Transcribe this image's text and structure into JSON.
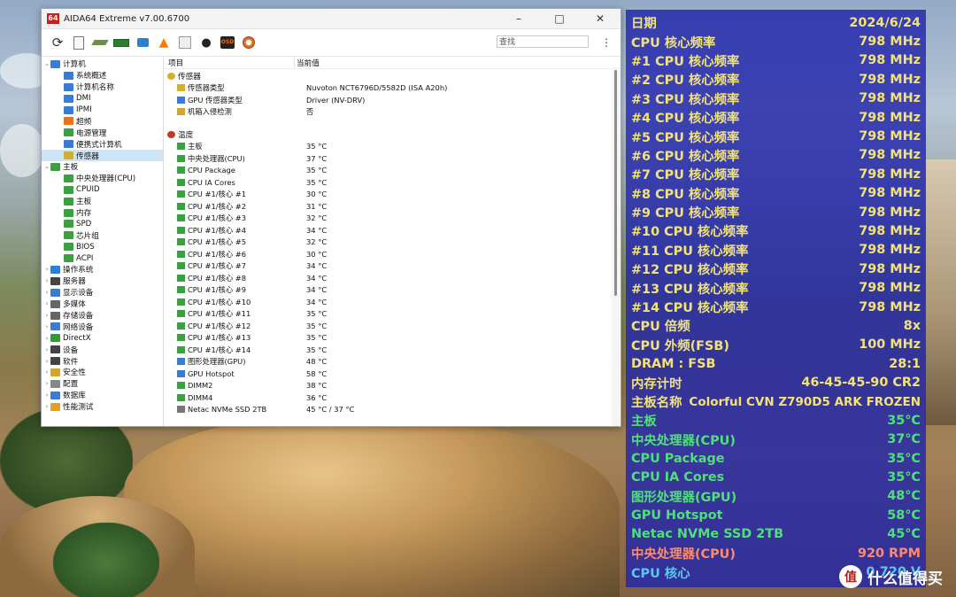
{
  "window": {
    "logo": "64",
    "title": "AIDA64 Extreme v7.00.6700",
    "controls": [
      "–",
      "□",
      "✕"
    ]
  },
  "toolbar": {
    "icons": [
      "refresh-icon",
      "report-icon",
      "motherboard-icon",
      "memory-icon",
      "network-icon",
      "flame-icon",
      "chip-icon",
      "user-icon",
      "osd-icon",
      "gauge-icon"
    ],
    "osd_label": "OSD",
    "search_placeholder": "查找",
    "more": "⋮"
  },
  "tree": [
    {
      "label": "计算机",
      "level": 0,
      "expanded": true,
      "icon_color": "#3a7bd5"
    },
    {
      "label": "系统概述",
      "level": 1,
      "icon_color": "#3a7bd5"
    },
    {
      "label": "计算机名称",
      "level": 1,
      "icon_color": "#3a7bd5"
    },
    {
      "label": "DMI",
      "level": 1,
      "icon_color": "#3a7bd5"
    },
    {
      "label": "IPMI",
      "level": 1,
      "icon_color": "#3a7bd5"
    },
    {
      "label": "超频",
      "level": 1,
      "icon_color": "#e8731a"
    },
    {
      "label": "电源管理",
      "level": 1,
      "icon_color": "#3aa040"
    },
    {
      "label": "便携式计算机",
      "level": 1,
      "icon_color": "#3a7bd5"
    },
    {
      "label": "传感器",
      "level": 1,
      "icon_color": "#d4b02a",
      "selected": true
    },
    {
      "label": "主板",
      "level": 0,
      "expanded": true,
      "icon_color": "#3aa040"
    },
    {
      "label": "中央处理器(CPU)",
      "level": 1,
      "icon_color": "#3aa040"
    },
    {
      "label": "CPUID",
      "level": 1,
      "icon_color": "#3aa040"
    },
    {
      "label": "主板",
      "level": 1,
      "icon_color": "#3aa040"
    },
    {
      "label": "内存",
      "level": 1,
      "icon_color": "#3aa040"
    },
    {
      "label": "SPD",
      "level": 1,
      "icon_color": "#3aa040"
    },
    {
      "label": "芯片组",
      "level": 1,
      "icon_color": "#3aa040"
    },
    {
      "label": "BIOS",
      "level": 1,
      "icon_color": "#3aa040"
    },
    {
      "label": "ACPI",
      "level": 1,
      "icon_color": "#3aa040"
    },
    {
      "label": "操作系统",
      "level": 0,
      "expanded": false,
      "icon_color": "#2a7fd8"
    },
    {
      "label": "服务器",
      "level": 0,
      "expanded": false,
      "icon_color": "#444444"
    },
    {
      "label": "显示设备",
      "level": 0,
      "expanded": false,
      "icon_color": "#3a7bd5"
    },
    {
      "label": "多媒体",
      "level": 0,
      "expanded": false,
      "icon_color": "#666666"
    },
    {
      "label": "存储设备",
      "level": 0,
      "expanded": false,
      "icon_color": "#666666"
    },
    {
      "label": "网络设备",
      "level": 0,
      "expanded": false,
      "icon_color": "#3a7bd5"
    },
    {
      "label": "DirectX",
      "level": 0,
      "expanded": false,
      "icon_color": "#2aa02a"
    },
    {
      "label": "设备",
      "level": 0,
      "expanded": false,
      "icon_color": "#444444"
    },
    {
      "label": "软件",
      "level": 0,
      "expanded": false,
      "icon_color": "#444444"
    },
    {
      "label": "安全性",
      "level": 0,
      "expanded": false,
      "icon_color": "#d4a52a"
    },
    {
      "label": "配置",
      "level": 0,
      "expanded": false,
      "icon_color": "#888888"
    },
    {
      "label": "数据库",
      "level": 0,
      "expanded": false,
      "icon_color": "#3a7bd5"
    },
    {
      "label": "性能测试",
      "level": 0,
      "expanded": false,
      "icon_color": "#e8a01a"
    }
  ],
  "list": {
    "headers": [
      "项目",
      "当前值"
    ],
    "sections": [
      {
        "title": "传感器",
        "icon_color": "#d4b02a",
        "rows": [
          {
            "name": "传感器类型",
            "value": "Nuvoton NCT6796D/5582D  (ISA A20h)",
            "icon_color": "#d4b02a"
          },
          {
            "name": "GPU 传感器类型",
            "value": "Driver  (NV-DRV)",
            "icon_color": "#3a7bd5"
          },
          {
            "name": "机箱入侵检测",
            "value": "否",
            "icon_color": "#d4a52a"
          }
        ]
      },
      {
        "title": "温度",
        "icon_color": "#c0392b",
        "rows": [
          {
            "name": "主板",
            "value": "35 °C",
            "icon_color": "#3aa040"
          },
          {
            "name": "中央处理器(CPU)",
            "value": "37 °C",
            "icon_color": "#3aa040"
          },
          {
            "name": "CPU Package",
            "value": "35 °C",
            "icon_color": "#3aa040"
          },
          {
            "name": "CPU IA Cores",
            "value": "35 °C",
            "icon_color": "#3aa040"
          },
          {
            "name": "CPU #1/核心 #1",
            "value": "30 °C",
            "icon_color": "#3aa040"
          },
          {
            "name": "CPU #1/核心 #2",
            "value": "31 °C",
            "icon_color": "#3aa040"
          },
          {
            "name": "CPU #1/核心 #3",
            "value": "32 °C",
            "icon_color": "#3aa040"
          },
          {
            "name": "CPU #1/核心 #4",
            "value": "34 °C",
            "icon_color": "#3aa040"
          },
          {
            "name": "CPU #1/核心 #5",
            "value": "32 °C",
            "icon_color": "#3aa040"
          },
          {
            "name": "CPU #1/核心 #6",
            "value": "30 °C",
            "icon_color": "#3aa040"
          },
          {
            "name": "CPU #1/核心 #7",
            "value": "34 °C",
            "icon_color": "#3aa040"
          },
          {
            "name": "CPU #1/核心 #8",
            "value": "34 °C",
            "icon_color": "#3aa040"
          },
          {
            "name": "CPU #1/核心 #9",
            "value": "34 °C",
            "icon_color": "#3aa040"
          },
          {
            "name": "CPU #1/核心 #10",
            "value": "34 °C",
            "icon_color": "#3aa040"
          },
          {
            "name": "CPU #1/核心 #11",
            "value": "35 °C",
            "icon_color": "#3aa040"
          },
          {
            "name": "CPU #1/核心 #12",
            "value": "35 °C",
            "icon_color": "#3aa040"
          },
          {
            "name": "CPU #1/核心 #13",
            "value": "35 °C",
            "icon_color": "#3aa040"
          },
          {
            "name": "CPU #1/核心 #14",
            "value": "35 °C",
            "icon_color": "#3aa040"
          },
          {
            "name": "图形处理器(GPU)",
            "value": "48 °C",
            "icon_color": "#3a7bd5"
          },
          {
            "name": "GPU Hotspot",
            "value": "58 °C",
            "icon_color": "#3a7bd5"
          },
          {
            "name": "DIMM2",
            "value": "38 °C",
            "icon_color": "#3aa040"
          },
          {
            "name": "DIMM4",
            "value": "36 °C",
            "icon_color": "#3aa040"
          },
          {
            "name": "Netac NVMe SSD 2TB",
            "value": "45 °C / 37 °C",
            "icon_color": "#777777"
          }
        ]
      }
    ]
  },
  "osd": {
    "rows": [
      {
        "label": "日期",
        "value": "2024/6/24",
        "color": "#f2e27a"
      },
      {
        "label": "CPU 核心频率",
        "value": "798 MHz",
        "color": "#f2e27a"
      },
      {
        "label": "#1 CPU 核心频率",
        "value": "798 MHz",
        "color": "#f2e27a"
      },
      {
        "label": "#2 CPU 核心频率",
        "value": "798 MHz",
        "color": "#f2e27a"
      },
      {
        "label": "#3 CPU 核心频率",
        "value": "798 MHz",
        "color": "#f2e27a"
      },
      {
        "label": "#4 CPU 核心频率",
        "value": "798 MHz",
        "color": "#f2e27a"
      },
      {
        "label": "#5 CPU 核心频率",
        "value": "798 MHz",
        "color": "#f2e27a"
      },
      {
        "label": "#6 CPU 核心频率",
        "value": "798 MHz",
        "color": "#f2e27a"
      },
      {
        "label": "#7 CPU 核心频率",
        "value": "798 MHz",
        "color": "#f2e27a"
      },
      {
        "label": "#8 CPU 核心频率",
        "value": "798 MHz",
        "color": "#f2e27a"
      },
      {
        "label": "#9 CPU 核心频率",
        "value": "798 MHz",
        "color": "#f2e27a"
      },
      {
        "label": "#10 CPU 核心频率",
        "value": "798 MHz",
        "color": "#f2e27a"
      },
      {
        "label": "#11 CPU 核心频率",
        "value": "798 MHz",
        "color": "#f2e27a"
      },
      {
        "label": "#12 CPU 核心频率",
        "value": "798 MHz",
        "color": "#f2e27a"
      },
      {
        "label": "#13 CPU 核心频率",
        "value": "798 MHz",
        "color": "#f2e27a"
      },
      {
        "label": "#14 CPU 核心频率",
        "value": "798 MHz",
        "color": "#f2e27a"
      },
      {
        "label": "CPU 倍频",
        "value": "8x",
        "color": "#f2e27a"
      },
      {
        "label": "CPU 外频(FSB)",
        "value": "100 MHz",
        "color": "#f2e27a"
      },
      {
        "label": "DRAM : FSB",
        "value": "28:1",
        "color": "#f2e27a"
      },
      {
        "label": "内存计时",
        "value": "46-45-45-90 CR2",
        "color": "#f2e27a"
      },
      {
        "label": "主板名称",
        "value": "Colorful CVN Z790D5 ARK FROZEN",
        "color": "#f2e27a"
      },
      {
        "label": "主板",
        "value": "35°C",
        "color": "#4fe07a"
      },
      {
        "label": "中央处理器(CPU)",
        "value": "37°C",
        "color": "#4fe07a"
      },
      {
        "label": "CPU Package",
        "value": "35°C",
        "color": "#4fe07a"
      },
      {
        "label": "CPU IA Cores",
        "value": "35°C",
        "color": "#4fe07a"
      },
      {
        "label": "图形处理器(GPU)",
        "value": "48°C",
        "color": "#4fe07a"
      },
      {
        "label": "GPU Hotspot",
        "value": "58°C",
        "color": "#4fe07a"
      },
      {
        "label": "Netac NVMe SSD 2TB",
        "value": "45°C",
        "color": "#4fe07a"
      },
      {
        "label": "中央处理器(CPU)",
        "value": "920 RPM",
        "color": "#ff8a6a"
      },
      {
        "label": "CPU 核心",
        "value": "0.720 V",
        "color": "#5cc8f2"
      }
    ]
  },
  "watermark": {
    "logo": "值",
    "text": "什么值得买"
  }
}
